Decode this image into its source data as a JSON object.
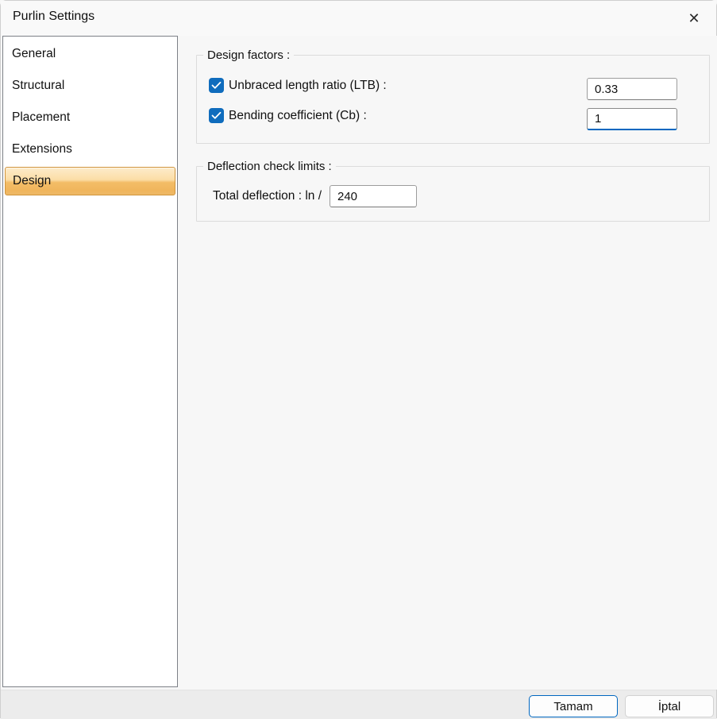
{
  "window": {
    "title": "Purlin Settings",
    "close_glyph": "✕"
  },
  "sidebar": {
    "items": [
      {
        "label": "General",
        "selected": false
      },
      {
        "label": "Structural",
        "selected": false
      },
      {
        "label": "Placement",
        "selected": false
      },
      {
        "label": "Extensions",
        "selected": false
      },
      {
        "label": "Design",
        "selected": true
      }
    ]
  },
  "design_factors": {
    "legend": "Design factors :",
    "rows": [
      {
        "label": "Unbraced length ratio (LTB) :",
        "checked": true,
        "value": "0.33"
      },
      {
        "label": "Bending coefficient (Cb) :",
        "checked": true,
        "value": "1"
      }
    ]
  },
  "deflection": {
    "legend": "Deflection check limits :",
    "label": "Total deflection : ln /",
    "value": "240"
  },
  "footer": {
    "ok_label": "Tamam",
    "cancel_label": "İptal"
  },
  "colors": {
    "accent_blue": "#0f6cbd",
    "focus_underline": "#0067c0",
    "selected_item_border": "#d1953c",
    "selected_item_gradient_top": "#fdeccb",
    "selected_item_gradient_bottom": "#eeb55c",
    "panel_background": "#f7f7f7",
    "footer_background": "#ececec"
  }
}
